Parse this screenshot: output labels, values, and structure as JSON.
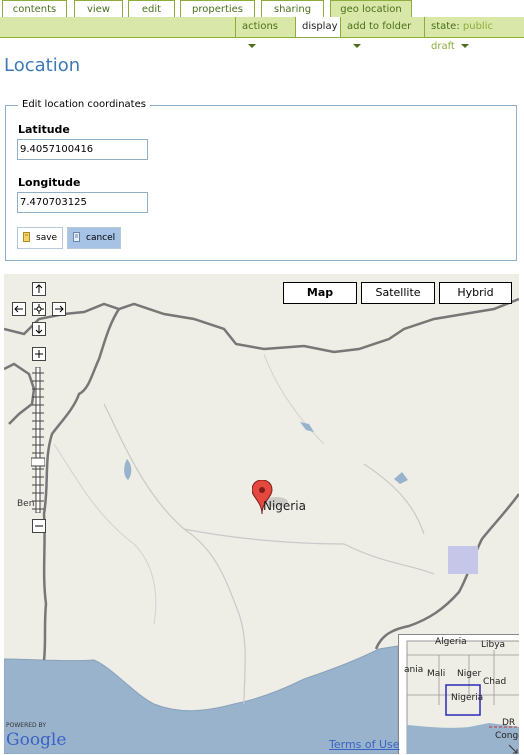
{
  "tabs": [
    "contents",
    "view",
    "edit",
    "properties",
    "sharing",
    "geo location"
  ],
  "actions": {
    "actions_label": "actions",
    "display_label": "display",
    "add_to_folder_label": "add to folder",
    "state_label": "state:",
    "state_value": "public draft"
  },
  "page_title": "Location",
  "form": {
    "legend": "Edit location coordinates",
    "latitude_label": "Latitude",
    "latitude_value": "9.4057100416",
    "longitude_label": "Longitude",
    "longitude_value": "7.470703125",
    "save_label": "save",
    "cancel_label": "cancel"
  },
  "map": {
    "type_buttons": [
      "Map",
      "Satellite",
      "Hybrid"
    ],
    "selected_type": "Map",
    "marker_label": "Nigeria",
    "left_label": "Ben",
    "terms_label": "Terms of Use",
    "powered_by": "POWERED BY",
    "logo_text": "Google",
    "overview_labels": [
      "Algeria",
      "Libya",
      "ania",
      "Mali",
      "Niger",
      "Chad",
      "Nigeria",
      "DR",
      "Congo"
    ],
    "colors": {
      "land": "#eeede6",
      "water": "#99b3cc",
      "border": "#777777",
      "marker": "#e4483e"
    }
  }
}
